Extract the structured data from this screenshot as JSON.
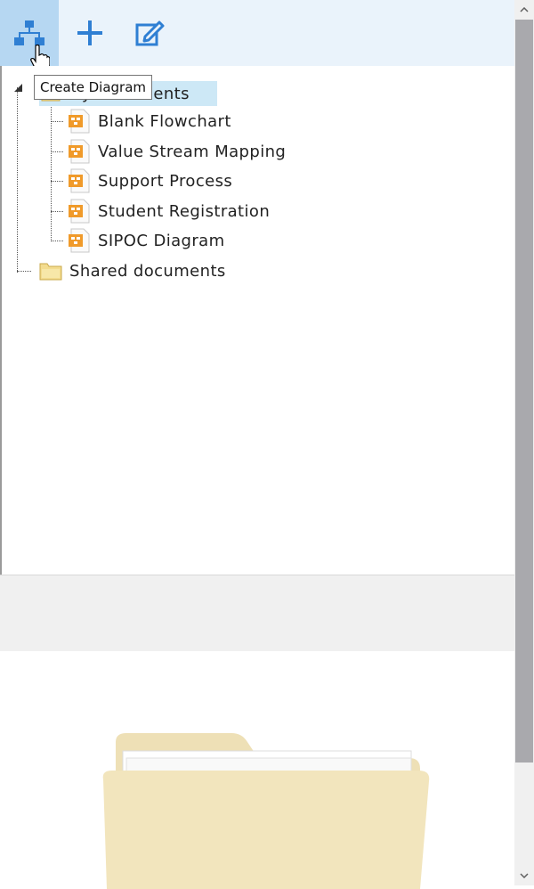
{
  "toolbar": {
    "buttons": [
      {
        "name": "create-diagram-button",
        "icon": "org-chart-icon"
      },
      {
        "name": "add-button",
        "icon": "plus-icon"
      },
      {
        "name": "edit-button",
        "icon": "edit-icon"
      }
    ],
    "tooltip": "Create Diagram"
  },
  "tree": {
    "root_folder": {
      "label": "My documents",
      "icon": "folder-icon"
    },
    "items": [
      {
        "label": "Blank Flowchart",
        "icon": "diagram-file-icon"
      },
      {
        "label": "Value Stream Mapping",
        "icon": "diagram-file-icon"
      },
      {
        "label": "Support Process",
        "icon": "diagram-file-icon"
      },
      {
        "label": "Student Registration",
        "icon": "diagram-file-icon"
      },
      {
        "label": "SIPOC Diagram",
        "icon": "diagram-file-icon"
      }
    ],
    "shared_folder": {
      "label": "Shared documents",
      "icon": "folder-icon"
    }
  },
  "colors": {
    "toolbar_bg": "#eaf3fb",
    "accent": "#2f7fd3",
    "selection": "#cde8f6",
    "file_icon": "#f09a2a",
    "folder": "#f3e3b5"
  }
}
